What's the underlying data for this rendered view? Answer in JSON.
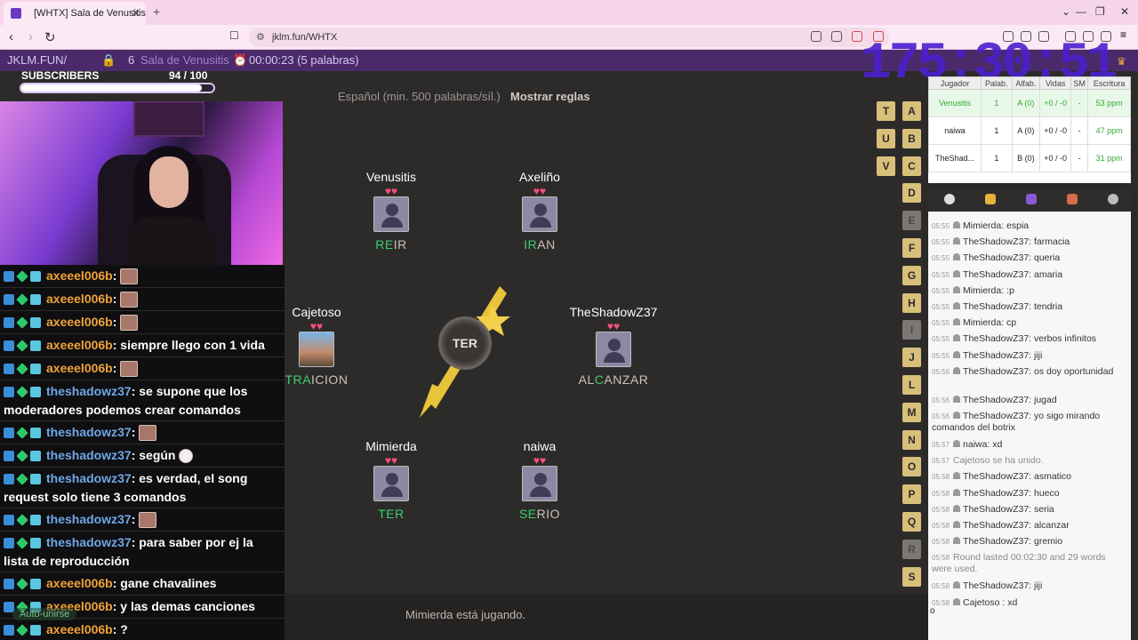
{
  "browser": {
    "tab_title": "[WHTX] Sala de Venusitis",
    "url": "jklm.fun/WHTX"
  },
  "gamebar": {
    "site": "JKLM.FUN/",
    "player_count": "6",
    "room_name": "Sala de Venusitis",
    "timer": "00:00:23 (5 palabras)"
  },
  "overlay": {
    "big_timer": "175:30:51",
    "subs_label": "SUBSCRIBERS",
    "subs_count": "94  / 100",
    "subs_progress": 0.94
  },
  "twitch_chat": [
    {
      "user": "axeeel006b",
      "color": "#f0a33a",
      "text": ":",
      "emote": true
    },
    {
      "user": "axeeel006b",
      "color": "#f0a33a",
      "text": ":",
      "emote": true
    },
    {
      "user": "axeeel006b",
      "color": "#f0a33a",
      "text": ":",
      "emote": true
    },
    {
      "user": "axeeel006b",
      "color": "#f0a33a",
      "text": ": siempre llego con 1 vida",
      "emote": false
    },
    {
      "user": "axeeel006b",
      "color": "#f0a33a",
      "text": ":",
      "emote": true
    },
    {
      "user": "theshadowz37",
      "color": "#6fa8e8",
      "text": ": se supone que los moderadores podemos crear comandos",
      "emote": false
    },
    {
      "user": "theshadowz37",
      "color": "#6fa8e8",
      "text": ":",
      "emote": true
    },
    {
      "user": "theshadowz37",
      "color": "#6fa8e8",
      "text": ": según",
      "emote": true
    },
    {
      "user": "theshadowz37",
      "color": "#6fa8e8",
      "text": ": es verdad, el song request solo tiene 3 comandos",
      "emote": false
    },
    {
      "user": "theshadowz37",
      "color": "#6fa8e8",
      "text": ":",
      "emote": true
    },
    {
      "user": "theshadowz37",
      "color": "#6fa8e8",
      "text": ": para saber por ej la lista de reproducción",
      "emote": false
    },
    {
      "user": "axeeel006b",
      "color": "#f0a33a",
      "text": ": gane chavalines",
      "emote": false
    },
    {
      "user": "axeeel006b",
      "color": "#f0a33a",
      "text": ": y las demas canciones",
      "emote": false
    },
    {
      "user": "axeeel006b",
      "color": "#f0a33a",
      "text": ": ?",
      "emote": false
    }
  ],
  "autojoin_label": "Auto-unirse",
  "game": {
    "rules_text": "Español (min. 500 palabras/síl.)",
    "rules_button": "Mostrar reglas",
    "syllable": "TER",
    "status": "Mimierda está jugando.",
    "players": [
      {
        "name": "Venusitis",
        "hit": "RE",
        "word_rest": "IR",
        "hearts": "♥♥"
      },
      {
        "name": "Axeliño",
        "hit": "IR",
        "word_rest": "AN",
        "hearts": "♥♥"
      },
      {
        "name": "Cajetoso",
        "hit": "TRA",
        "word_rest": "ICION",
        "hearts": "♥♥"
      },
      {
        "name": "TheShadowZ37",
        "hit": "AL",
        "word_rest": "ANZAR",
        "hearts": "♥♥"
      },
      {
        "name": "Mimierda",
        "hit": "TER",
        "word_rest": "",
        "hearts": "♥♥"
      },
      {
        "name": "naiwa",
        "hit": "SE",
        "word_rest": "RIO",
        "hearts": "♥♥"
      }
    ]
  },
  "letters_left": [
    "T",
    "U",
    "V"
  ],
  "letters_right": [
    "A",
    "B",
    "C",
    "D",
    "E",
    "F",
    "G",
    "H",
    "I",
    "J",
    "L",
    "M",
    "N",
    "O",
    "P",
    "Q",
    "R",
    "S"
  ],
  "used_letters": [
    "E",
    "I",
    "R"
  ],
  "scoreboard": {
    "headers": [
      "Jugador",
      "Palab.",
      "Alfab.",
      "Vidas",
      "SM",
      "Escritura"
    ],
    "rows": [
      {
        "player": "Venusitis",
        "words": "1",
        "alpha": "A (0)",
        "lives": "+0 / -0",
        "sm": "-",
        "wpm": "53 ppm"
      },
      {
        "player": "naiwa",
        "words": "1",
        "alpha": "A (0)",
        "lives": "+0 / -0",
        "sm": "-",
        "wpm": "47 ppm"
      },
      {
        "player": "TheShad...",
        "words": "1",
        "alpha": "B (0)",
        "lives": "+0 / -0",
        "sm": "-",
        "wpm": "31 ppm"
      }
    ]
  },
  "game_chat": [
    {
      "time": "05:55",
      "text": "Mimierda: espia"
    },
    {
      "time": "05:55",
      "text": "TheShadowZ37: farmacia"
    },
    {
      "time": "05:55",
      "text": "TheShadowZ37: queria"
    },
    {
      "time": "05:55",
      "text": "TheShadowZ37: amaria"
    },
    {
      "time": "05:55",
      "text": "Mimierda: :p"
    },
    {
      "time": "05:55",
      "text": "TheShadowZ37: tendria"
    },
    {
      "time": "05:55",
      "text": "Mimierda: cp"
    },
    {
      "time": "05:55",
      "text": "TheShadowZ37: verbos infinitos"
    },
    {
      "time": "05:55",
      "text": "TheShadowZ37: jiji"
    },
    {
      "time": "05:56",
      "text": "TheShadowZ37: os doy oportunidad"
    },
    {
      "time": "05:56",
      "text": "TheShadowZ37: jugad"
    },
    {
      "time": "05:56",
      "text": "TheShadowZ37: yo sigo mirando comandos del botrix"
    },
    {
      "time": "05:57",
      "text": "naiwa: xd"
    },
    {
      "time": "05:57",
      "text": "Cajetoso  se ha unido.",
      "sys": true
    },
    {
      "time": "05:58",
      "text": "TheShadowZ37: asmatico"
    },
    {
      "time": "05:58",
      "text": "TheShadowZ37: hueco"
    },
    {
      "time": "05:58",
      "text": "TheShadowZ37: seria"
    },
    {
      "time": "05:58",
      "text": "TheShadowZ37: alcanzar"
    },
    {
      "time": "05:58",
      "text": "TheShadowZ37: gremio"
    },
    {
      "time": "05:58",
      "text": "Round lasted 00:02:30 and 29 words were used.",
      "sys": true
    },
    {
      "time": "05:58",
      "text": "TheShadowZ37: jiji"
    },
    {
      "time": "05:58",
      "text": "Cajetoso : xd"
    }
  ],
  "chat_input_value": "o"
}
